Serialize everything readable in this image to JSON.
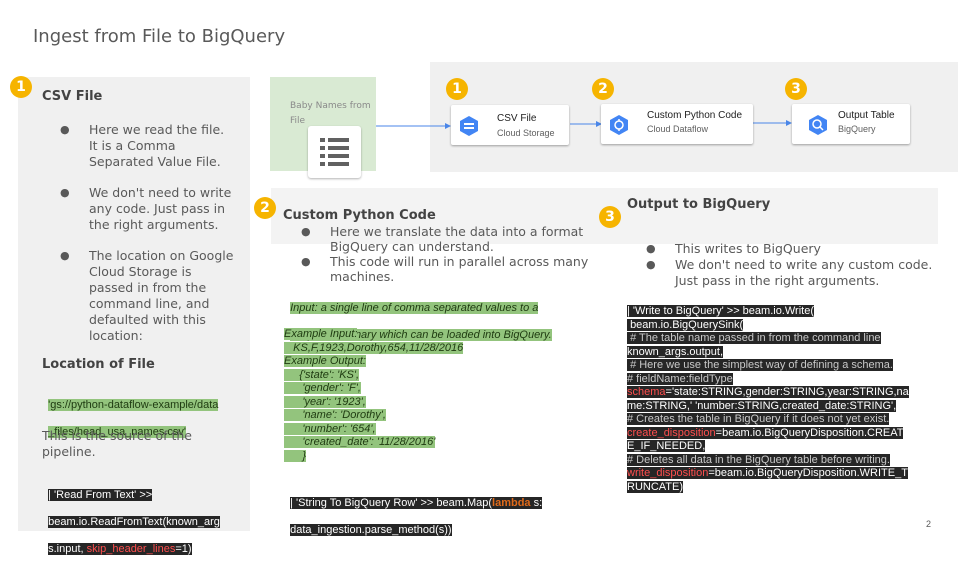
{
  "slide": {
    "title": "Ingest from File to BigQuery",
    "page_number": "2"
  },
  "left": {
    "badge": "1",
    "heading": "CSV File",
    "bullets": [
      [
        "Here we read the file.",
        "It is a Comma",
        "Separated Value File."
      ],
      [
        "We don't need to write",
        "any code.  Just pass in",
        "the right arguments."
      ],
      [
        "The location on Google",
        "Cloud Storage is",
        "passed in from the",
        "command line, and",
        "defaulted with this",
        "location:"
      ]
    ],
    "location_heading": "Location of File",
    "location_lines": [
      "'gs://python-dataflow-example/data",
      "_files/head_usa_names.csv'"
    ],
    "source_lines": [
      "This is the source of the",
      "pipeline."
    ],
    "code_line1": "| 'Read From Text' >>",
    "code_line2": "beam.io.ReadFromText(known_arg",
    "code_line3_a": "s.input, ",
    "code_line3_b": "skip_header_lines",
    "code_line3_c": "=1)"
  },
  "diagram": {
    "source_label_1": "Baby Names from",
    "source_label_2": "File",
    "source_icon": "list-icon",
    "nodes": [
      {
        "badge": "1",
        "title": "CSV File",
        "sub": "Cloud Storage",
        "icon": "cloud-storage-icon",
        "color": "#4285f4"
      },
      {
        "badge": "2",
        "title": "Custom Python Code",
        "sub": "Cloud Dataflow",
        "icon": "dataflow-icon",
        "color": "#4285f4"
      },
      {
        "badge": "3",
        "title": "Output Table",
        "sub": "BigQuery",
        "icon": "bigquery-icon",
        "color": "#4285f4"
      }
    ]
  },
  "middle": {
    "badge": "2",
    "heading": "Custom Python Code",
    "bullets": [
      [
        "Here we translate the data into a format",
        "BigQuery can understand."
      ],
      [
        "This code will run in parallel across many",
        "machines."
      ]
    ],
    "green_lines": [
      "Input: a single line of comma separated values to a",
      "Output: dictionary which can be loaded into BigQuery."
    ],
    "example_lines": [
      "Example Input:",
      "   KS,F,1923,Dorothy,654,11/28/2016",
      "Example Output:",
      "     {'state': 'KS',",
      "      'gender': 'F',",
      "      'year': '1923',",
      "      'name': 'Dorothy',",
      "      'number': '654',",
      "      'created_date': '11/28/2016'",
      "      }"
    ],
    "map_line1_a": "| 'String To BigQuery Row' >> beam.Map(",
    "map_line1_b": "lambda",
    "map_line1_c": " s:",
    "map_line2": "data_ingestion.parse_method(s))"
  },
  "right": {
    "badge": "3",
    "heading": "Output to BigQuery",
    "bullets": [
      [
        "This writes to BigQuery"
      ],
      [
        "We don't need to write any custom code.",
        "Just pass in the right arguments."
      ]
    ],
    "code": [
      {
        "parts": [
          {
            "t": "| 'Write to BigQuery' >> beam.io.Write(",
            "c": "white"
          }
        ]
      },
      {
        "parts": [
          {
            "t": " beam.io.BigQuerySink(",
            "c": "white"
          }
        ]
      },
      {
        "parts": [
          {
            "t": " # The table name passed in from the command line",
            "c": "grey"
          }
        ]
      },
      {
        "parts": [
          {
            "t": "known_args.output,",
            "c": "white"
          }
        ]
      },
      {
        "parts": [
          {
            "t": " # Here we use the simplest way of defining a schema.",
            "c": "grey"
          }
        ]
      },
      {
        "parts": [
          {
            "t": "# fieldName:fieldType",
            "c": "grey"
          }
        ]
      },
      {
        "parts": [
          {
            "t": "schema",
            "c": "red"
          },
          {
            "t": "='state:STRING,gender:STRING,year:STRING,na",
            "c": "white"
          }
        ]
      },
      {
        "parts": [
          {
            "t": "me:STRING,' 'number:STRING,created_date:STRING',",
            "c": "white"
          }
        ]
      },
      {
        "parts": [
          {
            "t": "# Creates the table in BigQuery if it does not yet exist.",
            "c": "grey"
          }
        ]
      },
      {
        "parts": [
          {
            "t": "create_disposition",
            "c": "red"
          },
          {
            "t": "=beam.io.BigQueryDisposition.CREAT",
            "c": "white"
          }
        ]
      },
      {
        "parts": [
          {
            "t": "E_IF_NEEDED,",
            "c": "white"
          }
        ]
      },
      {
        "parts": [
          {
            "t": "# Deletes all data in the BigQuery table before writing.",
            "c": "grey"
          }
        ]
      },
      {
        "parts": [
          {
            "t": "write_disposition",
            "c": "red"
          },
          {
            "t": "=beam.io.BigQueryDisposition.WRITE_T",
            "c": "white"
          }
        ]
      },
      {
        "parts": [
          {
            "t": "RUNCATE)",
            "c": "white"
          }
        ]
      }
    ]
  },
  "colors": {
    "badge": "#f6b400",
    "panel": "#f0f0f0",
    "green_highlight": "#93c47d",
    "code_bg": "#262626",
    "keyword_red": "#ff4e4e",
    "lambda_orange": "#e06a1a",
    "arrow": "#4a86e8"
  }
}
